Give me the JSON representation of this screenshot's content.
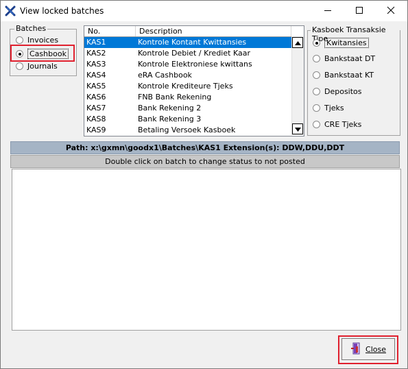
{
  "window": {
    "title": "View locked batches",
    "icon": "app-x-icon",
    "controls": [
      "minimize-icon",
      "maximize-icon",
      "close-icon"
    ]
  },
  "batches": {
    "legend": "Batches",
    "options": [
      {
        "label": "Invoices",
        "selected": false
      },
      {
        "label": "Cashbook",
        "selected": true
      },
      {
        "label": "Journals",
        "selected": false
      }
    ]
  },
  "batch_list": {
    "columns": [
      "No.",
      "Description"
    ],
    "rows": [
      {
        "no": "KAS1",
        "description": "Kontrole Kontant Kwittansies",
        "selected": true
      },
      {
        "no": "KAS2",
        "description": "Kontrole Debiet / Krediet Kaar",
        "selected": false
      },
      {
        "no": "KAS3",
        "description": "Kontrole Elektroniese kwittans",
        "selected": false
      },
      {
        "no": "KAS4",
        "description": "eRA Cashbook",
        "selected": false
      },
      {
        "no": "KAS5",
        "description": "Kontrole Krediteure Tjeks",
        "selected": false
      },
      {
        "no": "KAS6",
        "description": "FNB Bank Rekening",
        "selected": false
      },
      {
        "no": "KAS7",
        "description": "Bank Rekening 2",
        "selected": false
      },
      {
        "no": "KAS8",
        "description": "Bank Rekening 3",
        "selected": false
      },
      {
        "no": "KAS9",
        "description": "Betaling Versoek Kasboek",
        "selected": false
      }
    ]
  },
  "transaction_type": {
    "legend": "Kasboek Transaksie Tipe",
    "options": [
      {
        "label": "Kwitansies",
        "selected": true
      },
      {
        "label": "Bankstaat DT",
        "selected": false
      },
      {
        "label": "Bankstaat KT",
        "selected": false
      },
      {
        "label": "Depositos",
        "selected": false
      },
      {
        "label": "Tjeks",
        "selected": false
      },
      {
        "label": "CRE Tjeks",
        "selected": false
      }
    ]
  },
  "path_bar": "Path: x:\\gxmn\\goodx1\\Batches\\KAS1  Extension(s): DDW,DDU,DDT",
  "hint_bar": "Double click on batch to change status to not posted",
  "close_button": {
    "label": "Close",
    "icon": "door-exit-icon"
  },
  "highlight_color": "#e0202e",
  "selection_color": "#0078d7"
}
